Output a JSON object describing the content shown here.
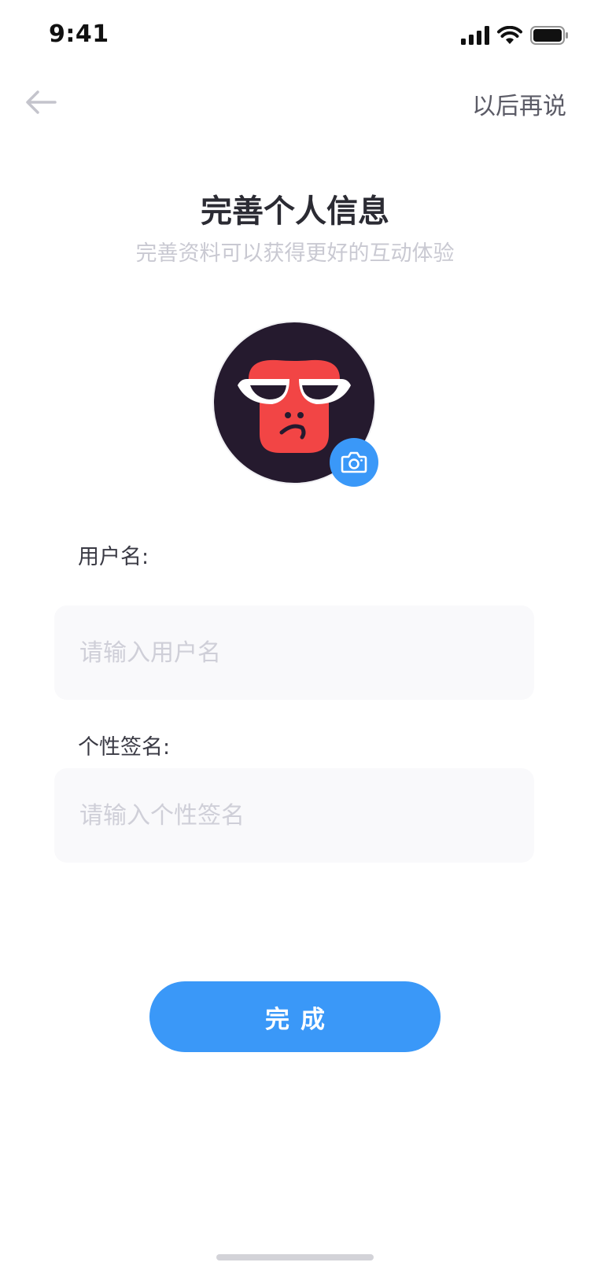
{
  "status_bar": {
    "time": "9:41",
    "signal_icon": "cellular-signal-icon",
    "wifi_icon": "wifi-icon",
    "battery_icon": "battery-icon"
  },
  "nav": {
    "back_icon": "arrow-left-icon",
    "skip_label": "以后再说"
  },
  "header": {
    "title": "完善个人信息",
    "subtitle": "完善资料可以获得更好的互动体验"
  },
  "avatar": {
    "image": "monkey-avatar",
    "edit_icon": "camera-icon"
  },
  "form": {
    "username": {
      "label": "用户名:",
      "placeholder": "请输入用户名",
      "value": ""
    },
    "signature": {
      "label": "个性签名:",
      "placeholder": "请输入个性签名",
      "value": ""
    }
  },
  "submit_label": "完成",
  "colors": {
    "accent": "#3a98f8",
    "title": "#2b2b33",
    "subtitle": "#c9c9d2",
    "field_bg": "#f9f9fb",
    "avatar_bg": "#251a2e",
    "avatar_face": "#f24545"
  }
}
